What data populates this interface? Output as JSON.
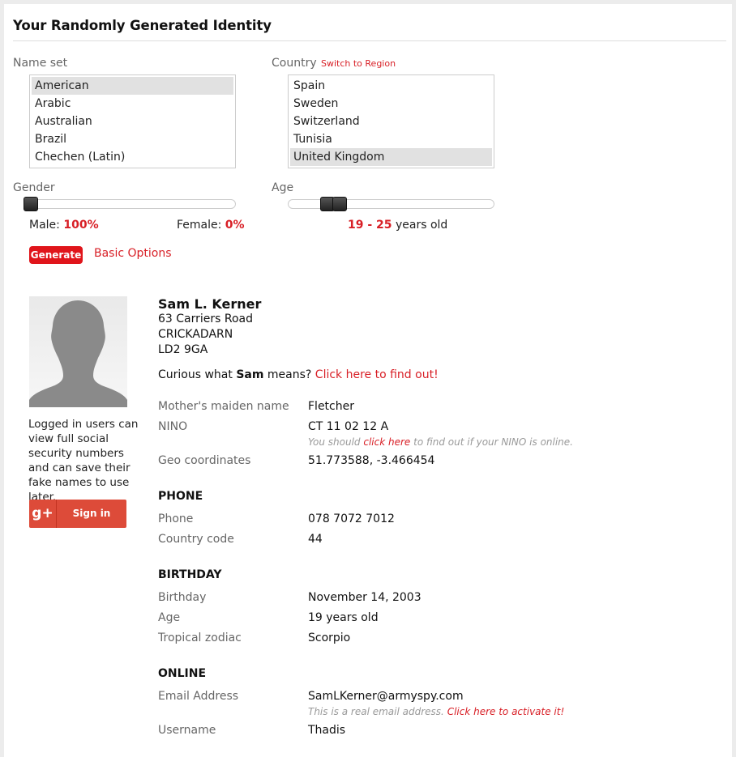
{
  "page_title": "Your Randomly Generated Identity",
  "name_set": {
    "label": "Name set",
    "options": [
      "American",
      "Arabic",
      "Australian",
      "Brazil",
      "Chechen (Latin)"
    ],
    "selected": "American"
  },
  "country": {
    "label": "Country",
    "switch_link": "Switch to Region",
    "options": [
      "Spain",
      "Sweden",
      "Switzerland",
      "Tunisia",
      "United Kingdom"
    ],
    "selected": "United Kingdom"
  },
  "gender": {
    "label": "Gender",
    "male_label": "Male:",
    "male_value": "100%",
    "female_label": "Female:",
    "female_value": "0%",
    "male_fraction": 1.0
  },
  "age": {
    "label": "Age",
    "min": "19",
    "dash": " - ",
    "max": "25",
    "suffix": "years old"
  },
  "actions": {
    "generate": "Generate",
    "basic_options": "Basic Options"
  },
  "sidebar": {
    "note": "Logged in users can view full social security numbers and can save their fake names to use later.",
    "gplus_icon": "g+",
    "signin": "Sign in"
  },
  "identity": {
    "name": "Sam L. Kerner",
    "address_line1": "63 Carriers Road",
    "address_line2": "CRICKADARN",
    "address_line3": "LD2 9GA",
    "curious_prefix": "Curious what",
    "first_name": "Sam",
    "curious_mid": "means?",
    "curious_link": "Click here to find out!"
  },
  "details": {
    "mmn_label": "Mother's maiden name",
    "mmn_value": "Fletcher",
    "nino_label": "NINO",
    "nino_value": "CT 11 02 12 A",
    "nino_hint_pre": "You should",
    "nino_hint_link": "click here",
    "nino_hint_post": "to find out if your NINO is online.",
    "geo_label": "Geo coordinates",
    "geo_value": "51.773588, -3.466454"
  },
  "phone": {
    "heading": "PHONE",
    "phone_label": "Phone",
    "phone_value": "078 7072 7012",
    "cc_label": "Country code",
    "cc_value": "44"
  },
  "birthday": {
    "heading": "BIRTHDAY",
    "birthday_label": "Birthday",
    "birthday_value": "November 14, 2003",
    "age_label": "Age",
    "age_value": "19 years old",
    "zodiac_label": "Tropical zodiac",
    "zodiac_value": "Scorpio"
  },
  "online": {
    "heading": "ONLINE",
    "email_label": "Email Address",
    "email_value": "SamLKerner@armyspy.com",
    "email_hint_pre": "This is a real email address.",
    "email_hint_link": "Click here to activate it!",
    "username_label": "Username",
    "username_value": "Thadis"
  },
  "colors": {
    "accent": "#d81f26",
    "button_bg": "#e0151b",
    "gplus_bg": "#dd4b39",
    "selected_row": "#e1e1e1"
  }
}
